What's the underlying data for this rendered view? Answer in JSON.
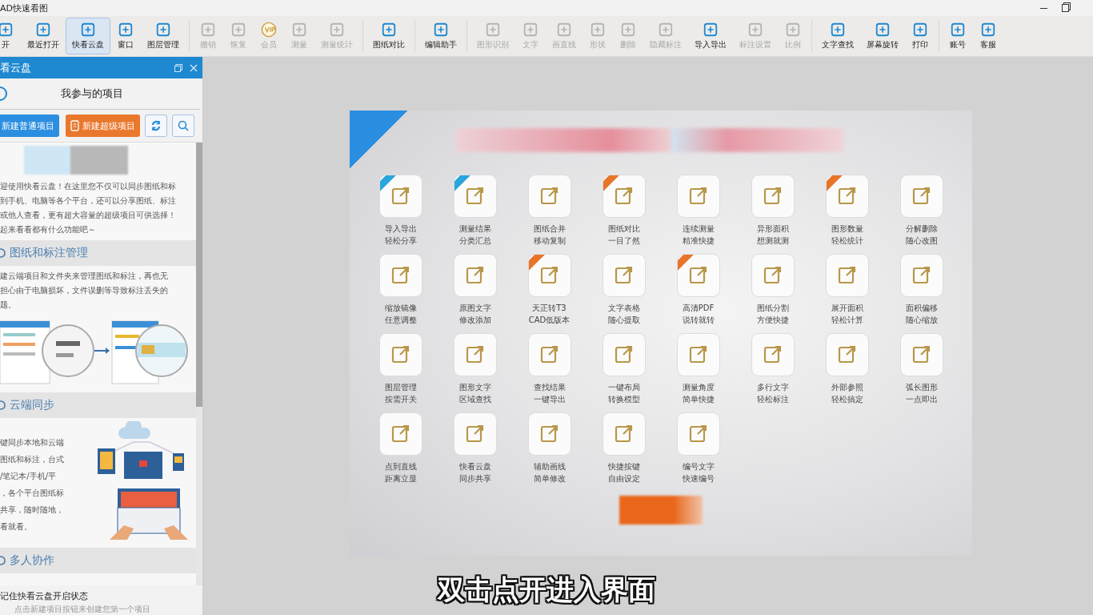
{
  "window": {
    "title": "AD快速看图"
  },
  "toolbar": [
    {
      "label": "开",
      "kind": "tool",
      "disabled": false,
      "selected": false
    },
    {
      "label": "最近打开",
      "kind": "tool",
      "disabled": false,
      "selected": false
    },
    {
      "label": "快看云盘",
      "kind": "tool",
      "disabled": false,
      "selected": true
    },
    {
      "label": "窗口",
      "kind": "tool",
      "disabled": false,
      "selected": false
    },
    {
      "label": "图层管理",
      "kind": "tool",
      "disabled": false,
      "selected": false,
      "divider_after": true
    },
    {
      "label": "撤销",
      "kind": "tool",
      "disabled": true,
      "selected": false
    },
    {
      "label": "恢复",
      "kind": "tool",
      "disabled": true,
      "selected": false
    },
    {
      "label": "会员",
      "kind": "vip",
      "disabled": true,
      "selected": false
    },
    {
      "label": "测量",
      "kind": "tool",
      "disabled": true,
      "selected": false
    },
    {
      "label": "测量统计",
      "kind": "tool",
      "disabled": true,
      "selected": false,
      "divider_after": true
    },
    {
      "label": "图纸对比",
      "kind": "tool",
      "disabled": false,
      "selected": false,
      "divider_after": true
    },
    {
      "label": "编辑助手",
      "kind": "tool",
      "disabled": false,
      "selected": false,
      "divider_after": true
    },
    {
      "label": "图形识别",
      "kind": "tool",
      "disabled": true,
      "selected": false
    },
    {
      "label": "文字",
      "kind": "tool",
      "disabled": true,
      "selected": false
    },
    {
      "label": "画直线",
      "kind": "tool",
      "disabled": true,
      "selected": false
    },
    {
      "label": "形状",
      "kind": "tool",
      "disabled": true,
      "selected": false
    },
    {
      "label": "删除",
      "kind": "tool",
      "disabled": true,
      "selected": false
    },
    {
      "label": "隐藏标注",
      "kind": "tool",
      "disabled": true,
      "selected": false
    },
    {
      "label": "导入导出",
      "kind": "tool",
      "disabled": false,
      "selected": false
    },
    {
      "label": "标注设置",
      "kind": "tool",
      "disabled": true,
      "selected": false
    },
    {
      "label": "比例",
      "kind": "tool",
      "disabled": true,
      "selected": false,
      "divider_after": true
    },
    {
      "label": "文字查找",
      "kind": "tool",
      "disabled": false,
      "selected": false
    },
    {
      "label": "屏幕旋转",
      "kind": "tool",
      "disabled": false,
      "selected": false
    },
    {
      "label": "打印",
      "kind": "tool",
      "disabled": false,
      "selected": false,
      "divider_after": true
    },
    {
      "label": "账号",
      "kind": "tool",
      "disabled": false,
      "selected": false
    },
    {
      "label": "客服",
      "kind": "tool",
      "disabled": false,
      "selected": false
    }
  ],
  "cloud_panel": {
    "title": "看云盘",
    "heading": "我参与的项目",
    "buttons": [
      {
        "label": "新建普通项目",
        "kind": "primary"
      },
      {
        "label": "新建超级项目",
        "kind": "accent"
      }
    ],
    "intro": [
      "迎使用快看云盘！在这里您不仅可以同步图纸和标",
      "到手机、电脑等各个平台，还可以分享图纸、标注",
      "或他人查看，更有超大容量的超级项目可供选择！",
      "起来看看都有什么功能吧～"
    ],
    "sections": [
      {
        "title": "图纸和标注管理",
        "kind": "manage",
        "lines": [
          "建云端项目和文件夹来管理图纸和标注，再也无",
          "担心由于电脑损坏，文件误删等导致标注丢失的",
          "题。"
        ]
      },
      {
        "title": "云端同步",
        "kind": "sync",
        "lines": [
          "键同步本地和云端",
          "图纸和标注，台式",
          "/笔记本/手机/平",
          "，各个平台图纸标",
          "共享，随时随地，",
          "看就看。"
        ]
      },
      {
        "title": "多人协作",
        "kind": "team"
      }
    ],
    "remember": "记住快看云盘开启状态",
    "hint": "点击新建项目按钮来创建您第一个项目"
  },
  "features": [
    {
      "lines": [
        "导入导出",
        "轻松分享"
      ],
      "color": "#2aa6dc"
    },
    {
      "lines": [
        "测量结果",
        "分类汇总"
      ],
      "color": "#2aa6dc"
    },
    {
      "lines": [
        "图纸合并",
        "移动复制"
      ]
    },
    {
      "lines": [
        "图纸对比",
        "一目了然"
      ],
      "color": "#e8742a"
    },
    {
      "lines": [
        "连续测量",
        "精准快捷"
      ]
    },
    {
      "lines": [
        "异形面积",
        "想测就测"
      ]
    },
    {
      "lines": [
        "图形数量",
        "轻松统计"
      ],
      "color": "#e8742a"
    },
    {
      "lines": [
        "分解删除",
        "随心改图"
      ]
    },
    {
      "lines": [
        "缩放镜像",
        "任意调整"
      ]
    },
    {
      "lines": [
        "原图文字",
        "修改添加"
      ]
    },
    {
      "lines": [
        "天正转T3",
        "CAD低版本"
      ],
      "color": "#e8742a"
    },
    {
      "lines": [
        "文字表格",
        "随心提取"
      ]
    },
    {
      "lines": [
        "高清PDF",
        "说转就转"
      ],
      "color": "#e8742a"
    },
    {
      "lines": [
        "图纸分割",
        "方便快捷"
      ]
    },
    {
      "lines": [
        "展开面积",
        "轻松计算"
      ]
    },
    {
      "lines": [
        "面积偏移",
        "随心缩放"
      ]
    },
    {
      "lines": [
        "图层管理",
        "按需开关"
      ]
    },
    {
      "lines": [
        "图形文字",
        "区域查找"
      ]
    },
    {
      "lines": [
        "查找结果",
        "一键导出"
      ]
    },
    {
      "lines": [
        "一键布局",
        "转换模型"
      ]
    },
    {
      "lines": [
        "测量角度",
        "简单快捷"
      ]
    },
    {
      "lines": [
        "多行文字",
        "轻松标注"
      ]
    },
    {
      "lines": [
        "外部参照",
        "轻松搞定"
      ]
    },
    {
      "lines": [
        "弧长图形",
        "一点即出"
      ]
    },
    {
      "lines": [
        "点到直线",
        "距离立显"
      ]
    },
    {
      "lines": [
        "快看云盘",
        "同步共享"
      ]
    },
    {
      "lines": [
        "辅助画线",
        "简单修改"
      ]
    },
    {
      "lines": [
        "快捷按键",
        "自由设定"
      ]
    },
    {
      "lines": [
        "编号文字",
        "快速编号"
      ]
    }
  ],
  "caption": "双击点开进入界面"
}
